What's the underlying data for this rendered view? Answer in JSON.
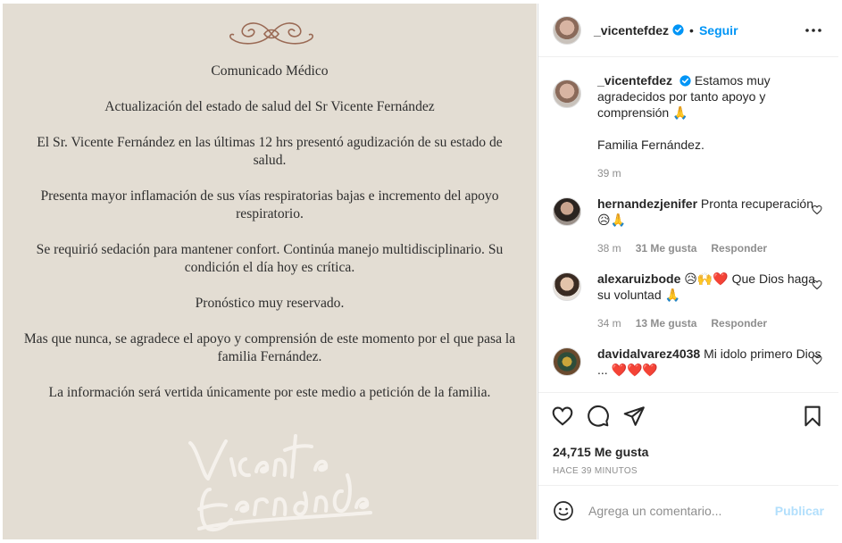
{
  "post_image": {
    "heading": "Comunicado Médico",
    "paragraphs": [
      "Actualización del estado de salud del Sr Vicente Fernández",
      "El Sr. Vicente Fernández en las últimas 12 hrs presentó agudización de su estado de salud.",
      "Presenta mayor inflamación de sus vías respiratorias bajas e incremento del apoyo respiratorio.",
      "Se requirió sedación para mantener confort. Continúa manejo multidisciplinario. Su condición el día hoy es crítica.",
      "Pronóstico muy reservado.",
      "Mas que nunca, se agradece el apoyo y comprensión de este momento por el que pasa la familia Fernández.",
      "La información será vertida únicamente por este medio a petición de la familia."
    ],
    "signature": "Vicente Fernández"
  },
  "header": {
    "username": "_vicentefdez",
    "separator": "•",
    "follow_label": "Seguir"
  },
  "caption": {
    "username": "_vicentefdez",
    "text": "Estamos muy agradecidos por tanto apoyo y comprensión 🙏",
    "text2": "Familia Fernández.",
    "time": "39 m"
  },
  "comments": [
    {
      "username": "hernandezjenifer",
      "text": "Pronta recuperación 😥🙏",
      "time": "38 m",
      "likes": "31 Me gusta",
      "reply": "Responder"
    },
    {
      "username": "alexaruizbode",
      "text": "😥🙌❤️ Que Dios haga su voluntad 🙏",
      "time": "34 m",
      "likes": "13 Me gusta",
      "reply": "Responder"
    },
    {
      "username": "davidalvarez4038",
      "text": "Mi idolo primero Dios ... ❤️❤️❤️",
      "time": "",
      "likes": "",
      "reply": ""
    }
  ],
  "actions": {
    "likes": "24,715 Me gusta",
    "time_ago": "HACE 39 MINUTOS"
  },
  "add_comment": {
    "placeholder": "Agrega un comentario...",
    "publish_label": "Publicar"
  },
  "colors": {
    "accent": "#0095f6",
    "publish_disabled": "#b2dffc",
    "image_bg": "#e3ddd3"
  }
}
